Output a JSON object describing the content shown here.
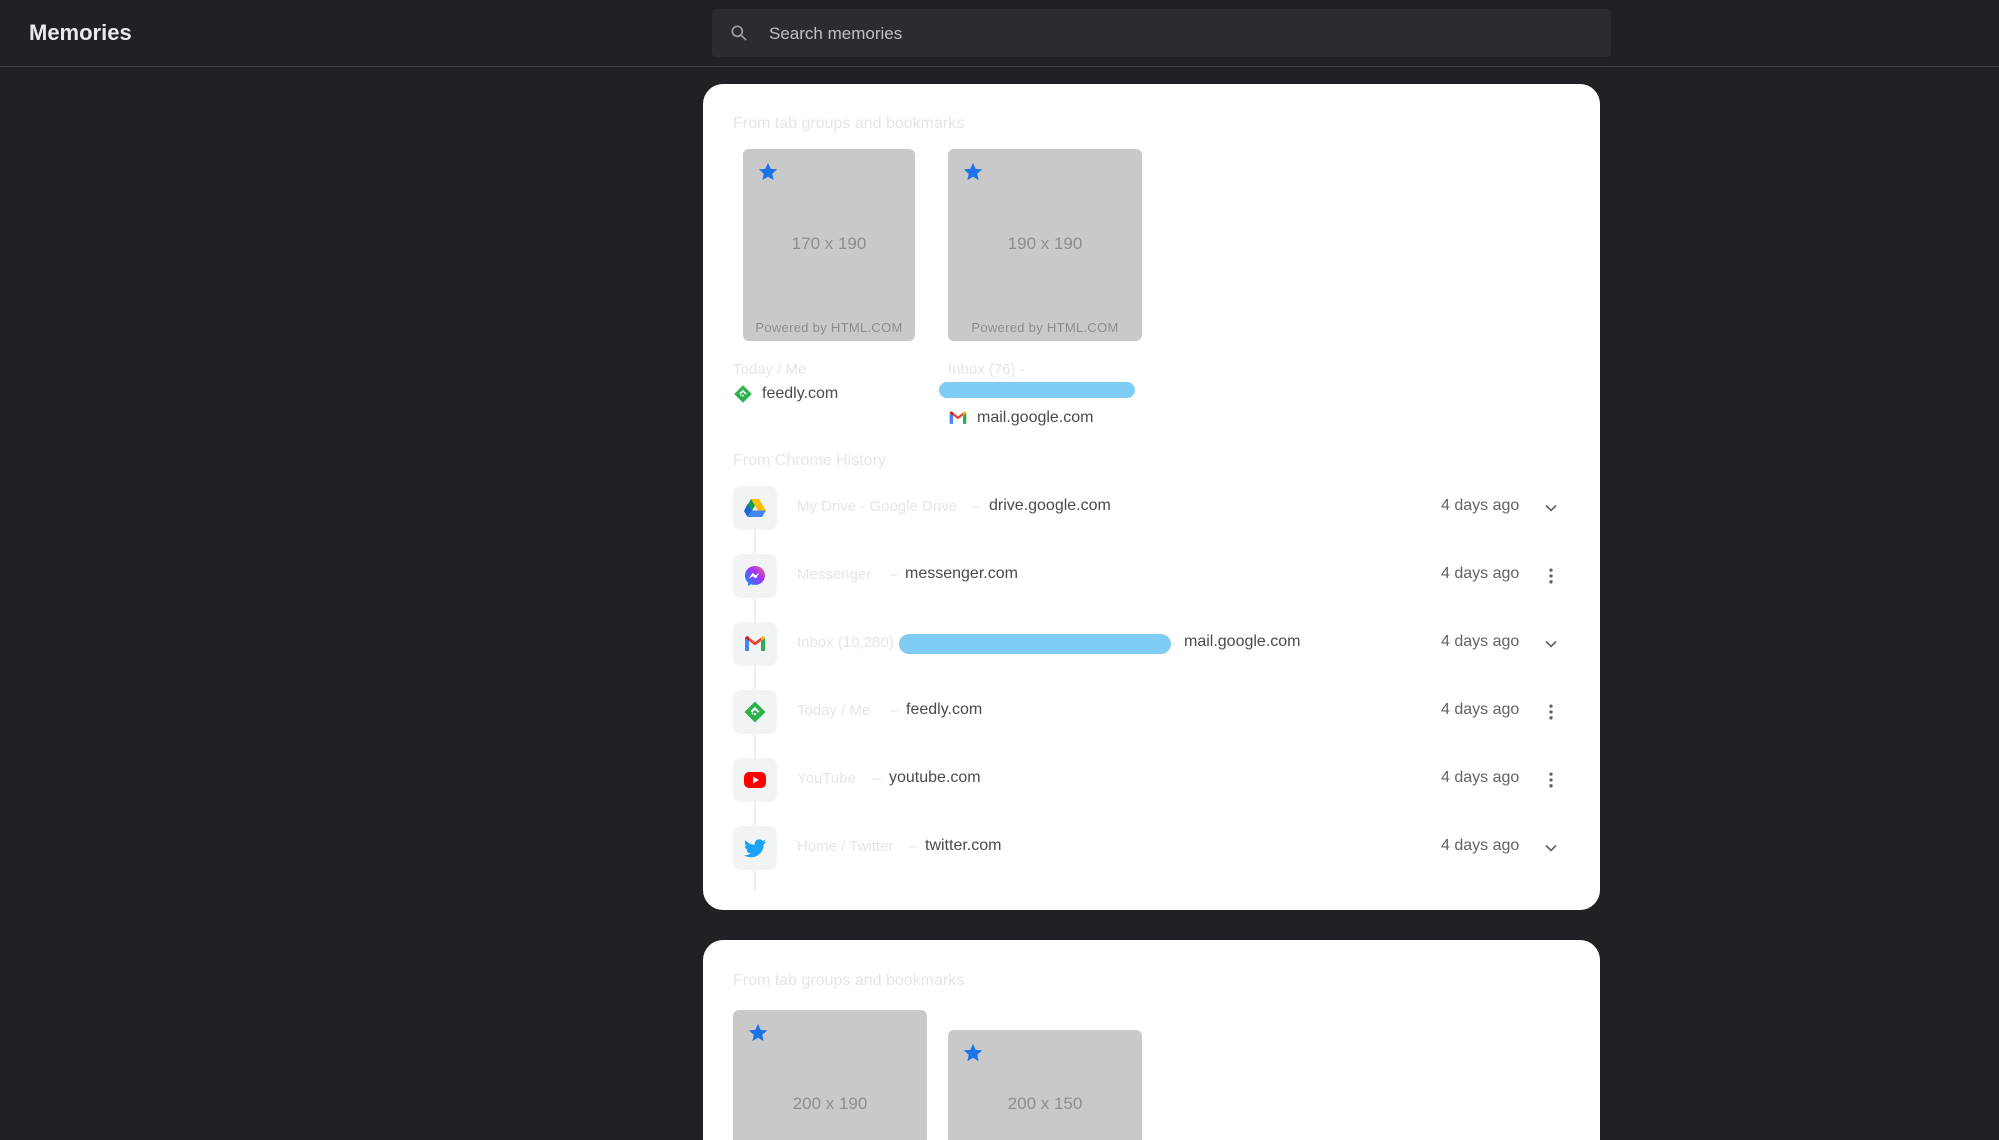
{
  "app": {
    "title": "Memories"
  },
  "search": {
    "placeholder": "Search memories"
  },
  "colors": {
    "background": "#202124",
    "card": "#ffffff",
    "star": "#1a73e8",
    "redaction": "#7fcdf5"
  },
  "cards": [
    {
      "bookmarks_title": "From tab groups and bookmarks",
      "tiles": [
        {
          "size_label": "170 x 190",
          "powered": "Powered by HTML.COM",
          "title": "Today / Me",
          "site": "feedly.com",
          "favicon": "feedly-icon",
          "starred": true
        },
        {
          "size_label": "190 x 190",
          "powered": "Powered by HTML.COM",
          "title": "Inbox (76) -",
          "site": "mail.google.com",
          "favicon": "gmail-icon",
          "starred": true
        }
      ],
      "history_title": "From Chrome History",
      "history": [
        {
          "title": "My Drive - Google Drive",
          "sep": "–",
          "domain": "drive.google.com",
          "time": "4 days ago",
          "icon": "google-drive-icon",
          "action": "chevron-down-icon"
        },
        {
          "title": "Messenger",
          "sep": "–",
          "domain": "messenger.com",
          "time": "4 days ago",
          "icon": "messenger-icon",
          "action": "more-vert-icon"
        },
        {
          "title": "Inbox (10,280)",
          "sep": "",
          "domain": "mail.google.com",
          "time": "4 days ago",
          "icon": "gmail-icon",
          "action": "chevron-down-icon"
        },
        {
          "title": "Today / Me",
          "sep": "–",
          "domain": "feedly.com",
          "time": "4 days ago",
          "icon": "feedly-icon",
          "action": "more-vert-icon"
        },
        {
          "title": "YouTube",
          "sep": "–",
          "domain": "youtube.com",
          "time": "4 days ago",
          "icon": "youtube-icon",
          "action": "more-vert-icon"
        },
        {
          "title": "Home / Twitter",
          "sep": "–",
          "domain": "twitter.com",
          "time": "4 days ago",
          "icon": "twitter-icon",
          "action": "chevron-down-icon"
        }
      ]
    },
    {
      "bookmarks_title": "From tab groups and bookmarks",
      "tiles": [
        {
          "size_label": "200 x 190",
          "starred": true
        },
        {
          "size_label": "200 x 150",
          "starred": true
        }
      ]
    }
  ]
}
